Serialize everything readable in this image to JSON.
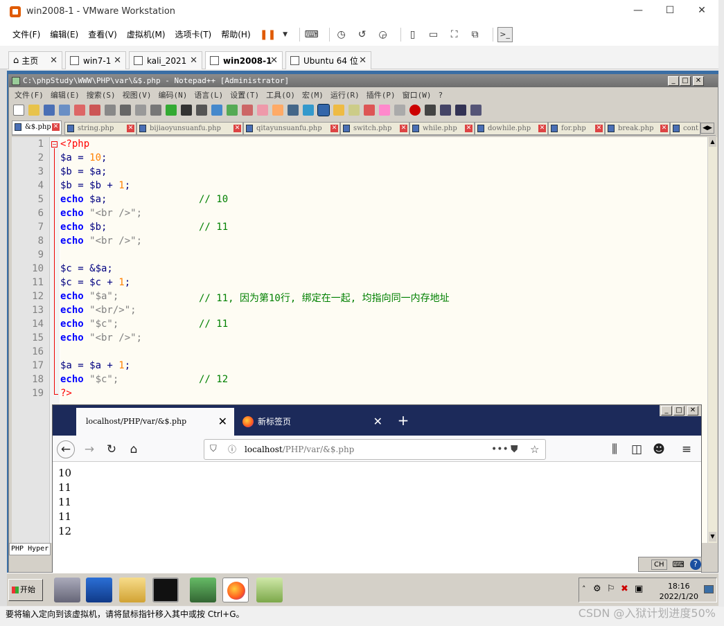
{
  "vmware": {
    "title": "win2008-1 - VMware Workstation",
    "menu": [
      "文件(F)",
      "编辑(E)",
      "查看(V)",
      "虚拟机(M)",
      "选项卡(T)",
      "帮助(H)"
    ],
    "tabs": [
      {
        "label": "主页"
      },
      {
        "label": "win7-1"
      },
      {
        "label": "kali_2021"
      },
      {
        "label": "win2008-1"
      },
      {
        "label": "Ubuntu 64 位"
      }
    ],
    "status_text": "要将输入定向到该虚拟机，请将鼠标指针移入其中或按 Ctrl+G。",
    "watermark": "CSDN @入狱计划进度50%"
  },
  "npp": {
    "title": "C:\\phpStudy\\WWW\\PHP\\var\\&$.php - Notepad++ [Administrator]",
    "menu": [
      "文件(F)",
      "编辑(E)",
      "搜索(S)",
      "视图(V)",
      "编码(N)",
      "语言(L)",
      "设置(T)",
      "工具(O)",
      "宏(M)",
      "运行(R)",
      "插件(P)",
      "窗口(W)",
      "?"
    ],
    "tabs": [
      "&$.php",
      "string.php",
      "bijiaoyunsuanfu.php",
      "qitayunsuanfu.php",
      "switch.php",
      "while.php",
      "dowhile.php",
      "for.php",
      "break.php",
      "cont"
    ],
    "line_numbers": [
      "1",
      "2",
      "3",
      "4",
      "5",
      "6",
      "7",
      "8",
      "9",
      "10",
      "11",
      "12",
      "13",
      "14",
      "15",
      "16",
      "17",
      "18",
      "19"
    ],
    "code": {
      "l1": "<?php",
      "l2a": "$a = ",
      "l2b": "10",
      "l2c": ";",
      "l3": "$b = $a;",
      "l4a": "$b = $b + ",
      "l4b": "1",
      "l4c": ";",
      "l5a": "echo",
      "l5b": " $a;",
      "l5c": "// 10",
      "l6a": "echo",
      "l6b": " \"<br />\";",
      "l7a": "echo",
      "l7b": " $b;",
      "l7c": "// 11",
      "l8a": "echo",
      "l8b": " \"<br />\";",
      "l10": "$c = &$a;",
      "l11a": "$c = $c + ",
      "l11b": "1",
      "l11c": ";",
      "l12a": "echo",
      "l12b": " \"$a\";",
      "l12c": "// 11, 因为第10行, 绑定在一起, 均指向同一内存地址",
      "l13a": "echo",
      "l13b": " \"<br/>\";",
      "l14a": "echo",
      "l14b": " \"$c\";",
      "l14c": "// 11",
      "l15a": "echo",
      "l15b": " \"<br />\";",
      "l17a": "$a = $a + ",
      "l17b": "1",
      "l17c": ";",
      "l18a": "echo",
      "l18b": " \"$c\";",
      "l18c": "// 12",
      "l19": "?>"
    },
    "status": "PHP Hyper"
  },
  "firefox": {
    "tab1": "localhost/PHP/var/&$.php",
    "tab2": "新标签页",
    "url_host": "localhost",
    "url_path": "/PHP/var/&$.php",
    "output": [
      "10",
      "11",
      "11",
      "11",
      "12"
    ]
  },
  "taskbar": {
    "start": "开始",
    "time": "18:16",
    "date": "2022/1/20",
    "ime": "CH"
  }
}
